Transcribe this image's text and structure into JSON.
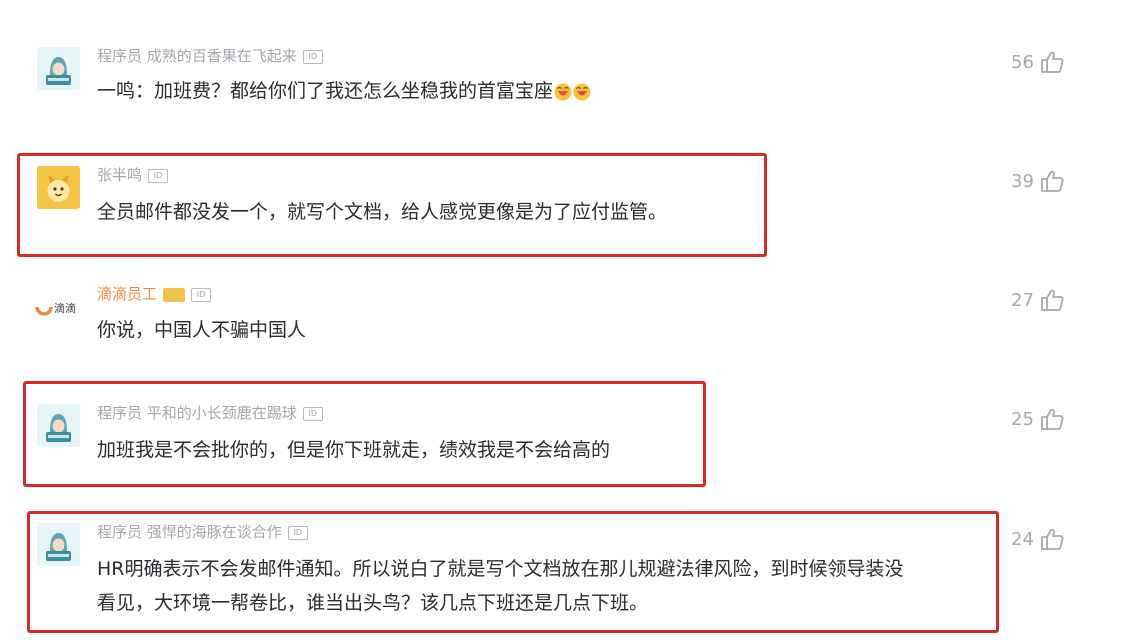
{
  "comments": [
    {
      "author": "程序员 成熟的百香果在飞起来",
      "text": "一鸣：加班费？都给你们了我还怎么坐稳我的首富宝座",
      "likes": "56",
      "avatar": "coder-avatar-icon",
      "highlighted": false
    },
    {
      "author": "张半鸣",
      "text": "全员邮件都没发一个，就写个文档，给人感觉更像是为了应付监管。",
      "likes": "39",
      "avatar": "yellow-pet-avatar-icon",
      "highlighted": true
    },
    {
      "author": "滴滴员工",
      "brand": "滴滴",
      "text": "你说，中国人不骗中国人",
      "likes": "27",
      "avatar": "didi-logo-icon",
      "highlighted": false
    },
    {
      "author": "程序员 平和的小长颈鹿在踢球",
      "text": "加班我是不会批你的，但是你下班就走，绩效我是不会给高的",
      "likes": "25",
      "avatar": "coder-avatar-icon",
      "highlighted": true
    },
    {
      "author": "程序员 强悍的海豚在谈合作",
      "text_line1": "HR明确表示不会发邮件通知。所以说白了就是写个文档放在那儿规避法律风险，到时候领导装没",
      "text_line2": "看见，大环境一帮卷比，谁当出头鸟？该几点下班还是几点下班。",
      "likes": "24",
      "avatar": "coder-avatar-icon",
      "highlighted": true
    }
  ],
  "badges": {
    "id": "ID"
  },
  "colors": {
    "highlight_border": "#d92a2a",
    "author_gray": "#a5a5ad",
    "author_orange": "#f08a3e",
    "text": "#2b2b31"
  }
}
